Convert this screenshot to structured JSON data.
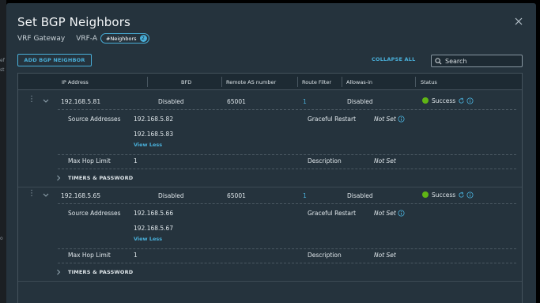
{
  "modal": {
    "title": "Set BGP Neighbors",
    "vrf_gateway_label": "VRF Gateway",
    "vrf_name": "VRF-A",
    "tag_label": "#Neighbors",
    "tag_count": "2"
  },
  "toolbar": {
    "add_label": "ADD BGP NEIGHBOR",
    "collapse_label": "COLLAPSE ALL",
    "search_placeholder": "Search"
  },
  "table": {
    "columns": [
      "IP Address",
      "BFD",
      "Remote AS number",
      "Route Filter",
      "Allowas-in",
      "Status"
    ]
  },
  "neighbors": [
    {
      "ip": "192.168.5.81",
      "bfd": "Disabled",
      "remote_as": "65001",
      "route_filter": "1",
      "allowas_in": "Disabled",
      "status": "Success",
      "source_addresses_label": "Source Addresses",
      "source_addresses": [
        "192.168.5.82",
        "192.168.5.83"
      ],
      "view_less": "View Less",
      "graceful_restart_label": "Graceful Restart",
      "graceful_restart": "Not Set",
      "max_hop_label": "Max Hop Limit",
      "max_hop": "1",
      "description_label": "Description",
      "description": "Not Set",
      "timers_label": "TIMERS & PASSWORD"
    },
    {
      "ip": "192.168.5.65",
      "bfd": "Disabled",
      "remote_as": "65001",
      "route_filter": "1",
      "allowas_in": "Disabled",
      "status": "Success",
      "source_addresses_label": "Source Addresses",
      "source_addresses": [
        "192.168.5.66",
        "192.168.5.67"
      ],
      "view_less": "View Less",
      "graceful_restart_label": "Graceful Restart",
      "graceful_restart": "Not Set",
      "max_hop_label": "Max Hop Limit",
      "max_hop": "1",
      "description_label": "Description",
      "description": "Not Set",
      "timers_label": "TIMERS & PASSWORD"
    }
  ],
  "colors": {
    "accent": "#49afd9",
    "success": "#60b515",
    "modal_bg": "#25333d",
    "header_bg": "#1d2a33"
  }
}
